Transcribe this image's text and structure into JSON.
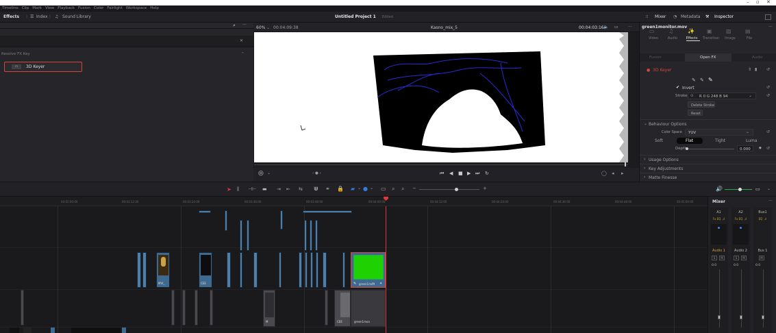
{
  "window": {
    "minimize": "–",
    "restore": "▫",
    "close": "✕"
  },
  "menu": [
    "Timeline",
    "Clip",
    "Mark",
    "View",
    "Playback",
    "Fusion",
    "Color",
    "Fairlight",
    "Workspace",
    "Help"
  ],
  "toolbar": {
    "effects": "Effects",
    "index": "Index",
    "sound_library": "Sound Library",
    "project_title": "Untitled Project 1",
    "project_status": "Edited",
    "mixer": "Mixer",
    "metadata": "Metadata",
    "inspector": "Inspector"
  },
  "effects_panel": {
    "section_title": "Resolve FX Key",
    "item_label": "3D Keyer"
  },
  "viewer": {
    "zoom": "60%",
    "source_timecode": "00:04:09:38",
    "clip_name": "Kasno_mix_5",
    "timecode": "00:04:03:16",
    "play_range": "‹ ● ›",
    "fit_in": "◯",
    "fit_out": "◯"
  },
  "inspector": {
    "file_name": "green1monitor.mov",
    "tabs": [
      "Video",
      "Audio",
      "Effects",
      "Transition",
      "Image",
      "File"
    ],
    "sub_tabs": [
      "Fusion",
      "Open FX",
      "Audio"
    ],
    "effect_name": "3D Keyer",
    "invert_label": "Invert",
    "stroke_label": "Stroke",
    "stroke_value": "R 0 G 248 B 94",
    "delete_stroke": "Delete Stroke",
    "reset": "Reset",
    "behaviour_options": "Behaviour Options",
    "color_space_label": "Color Space",
    "color_space_value": "YUV",
    "softness_options": [
      "Soft",
      "Flat",
      "Tight",
      "Luma"
    ],
    "depth_label": "Depth",
    "depth_value": "0.000",
    "usage_options": "Usage Options",
    "key_adjustments": "Key Adjustments",
    "matte_finesse": "Matte Finesse"
  },
  "ruler": {
    "ticks": [
      "00:02:00:00",
      "00:03:12:00",
      "00:03:24:00",
      "00:03:36:00",
      "00:03:48:00",
      "00:04:00:00",
      "00:04:12:00",
      "00:04:24:00",
      "00:04:36:00",
      "00:04:48:00",
      "00:05:00:00"
    ]
  },
  "clips": {
    "labels": [
      "MVI_",
      "CEE",
      "CEE",
      "green1mon"
    ],
    "v_label": "M"
  },
  "mixer": {
    "title": "Mixer",
    "channels": [
      "A1",
      "A2",
      "Bus1"
    ],
    "strip_names": [
      "Audio 1",
      "Audio 2",
      "Bus 1"
    ],
    "levels": [
      "0.0",
      "0.0",
      "0.0"
    ],
    "fx_labels": [
      "Fx EQ ..ıl",
      "Fx EQ ..ıl",
      "EQ ..ıl"
    ]
  },
  "colors": {
    "accent_red": "#d0473e",
    "playhead": "#e0363a",
    "clip_blue": "#4f7fa6",
    "key_green": "#1fd100",
    "stroke_blue": "#2a2ad6"
  }
}
